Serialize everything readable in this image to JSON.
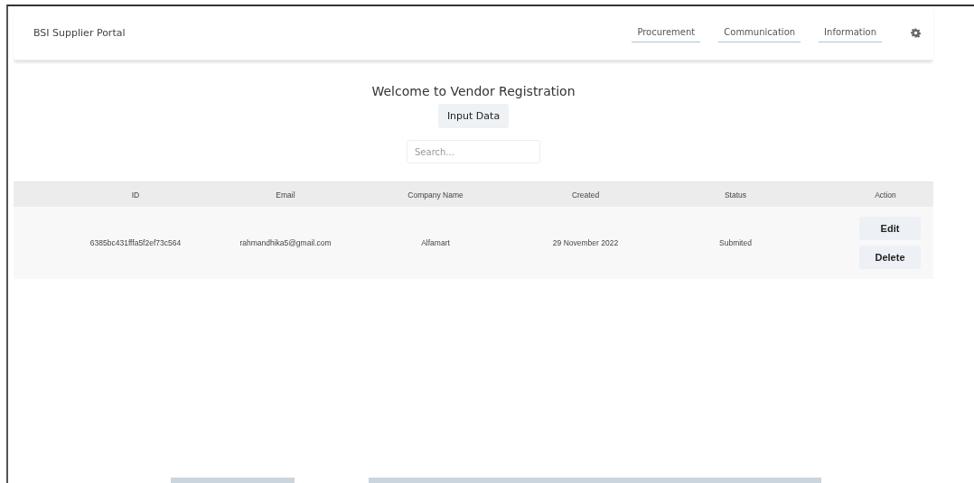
{
  "navbar": {
    "title": "BSI Supplier Portal",
    "links": [
      {
        "label": "Procurement"
      },
      {
        "label": "Communication"
      },
      {
        "label": "Information"
      }
    ]
  },
  "heading": "Welcome to Vendor Registration",
  "input_button": "Input Data",
  "search": {
    "placeholder": "Search..."
  },
  "table": {
    "columns": [
      "ID",
      "Email",
      "Company Name",
      "Created",
      "Status",
      "Action"
    ],
    "rows": [
      {
        "id": "6385bc431fffa5f2ef73c564",
        "email": "rahmandhika5@gmail.com",
        "company": "Alfamart",
        "created": "29 November 2022",
        "status": "Submited",
        "actions": [
          "Edit",
          "Delete"
        ]
      }
    ]
  }
}
